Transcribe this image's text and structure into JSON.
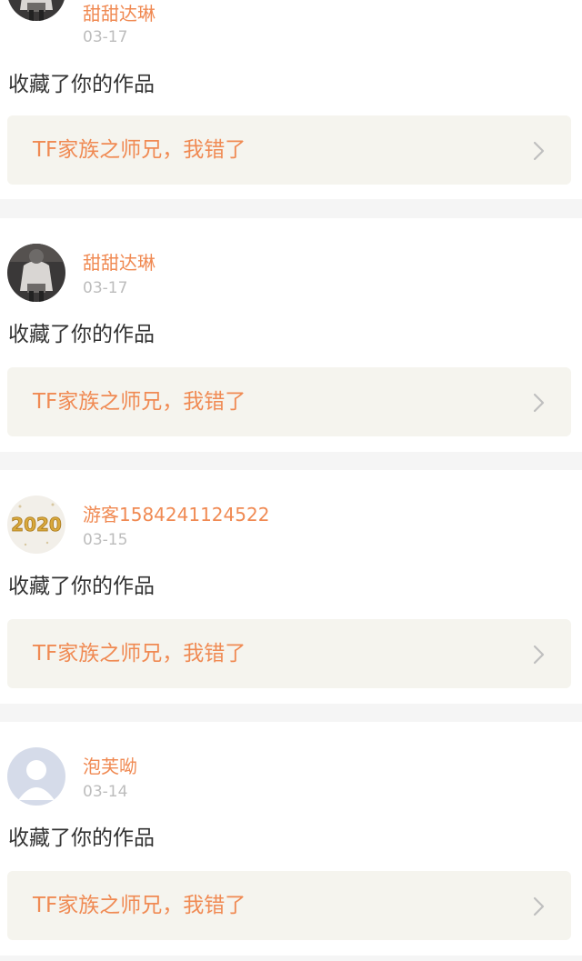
{
  "notifications": [
    {
      "username": "甜甜达琳",
      "date": "03-17",
      "action": "收藏了你的作品",
      "work_title": "TF家族之师兄，我错了",
      "avatar_icon": "photo-avatar"
    },
    {
      "username": "甜甜达琳",
      "date": "03-17",
      "action": "收藏了你的作品",
      "work_title": "TF家族之师兄，我错了",
      "avatar_icon": "photo-avatar"
    },
    {
      "username": "游客1584241124522",
      "date": "03-15",
      "action": "收藏了你的作品",
      "work_title": "TF家族之师兄，我错了",
      "avatar_icon": "2020-balloon-avatar",
      "avatar_text": "2020"
    },
    {
      "username": "泡芙呦",
      "date": "03-14",
      "action": "收藏了你的作品",
      "work_title": "TF家族之师兄，我错了",
      "avatar_icon": "default-user-avatar"
    }
  ],
  "colors": {
    "accent": "#f08a53",
    "date": "#bdbdbd",
    "text": "#333333",
    "link_bg": "#f5f4ee",
    "separator": "#f5f5f5"
  }
}
